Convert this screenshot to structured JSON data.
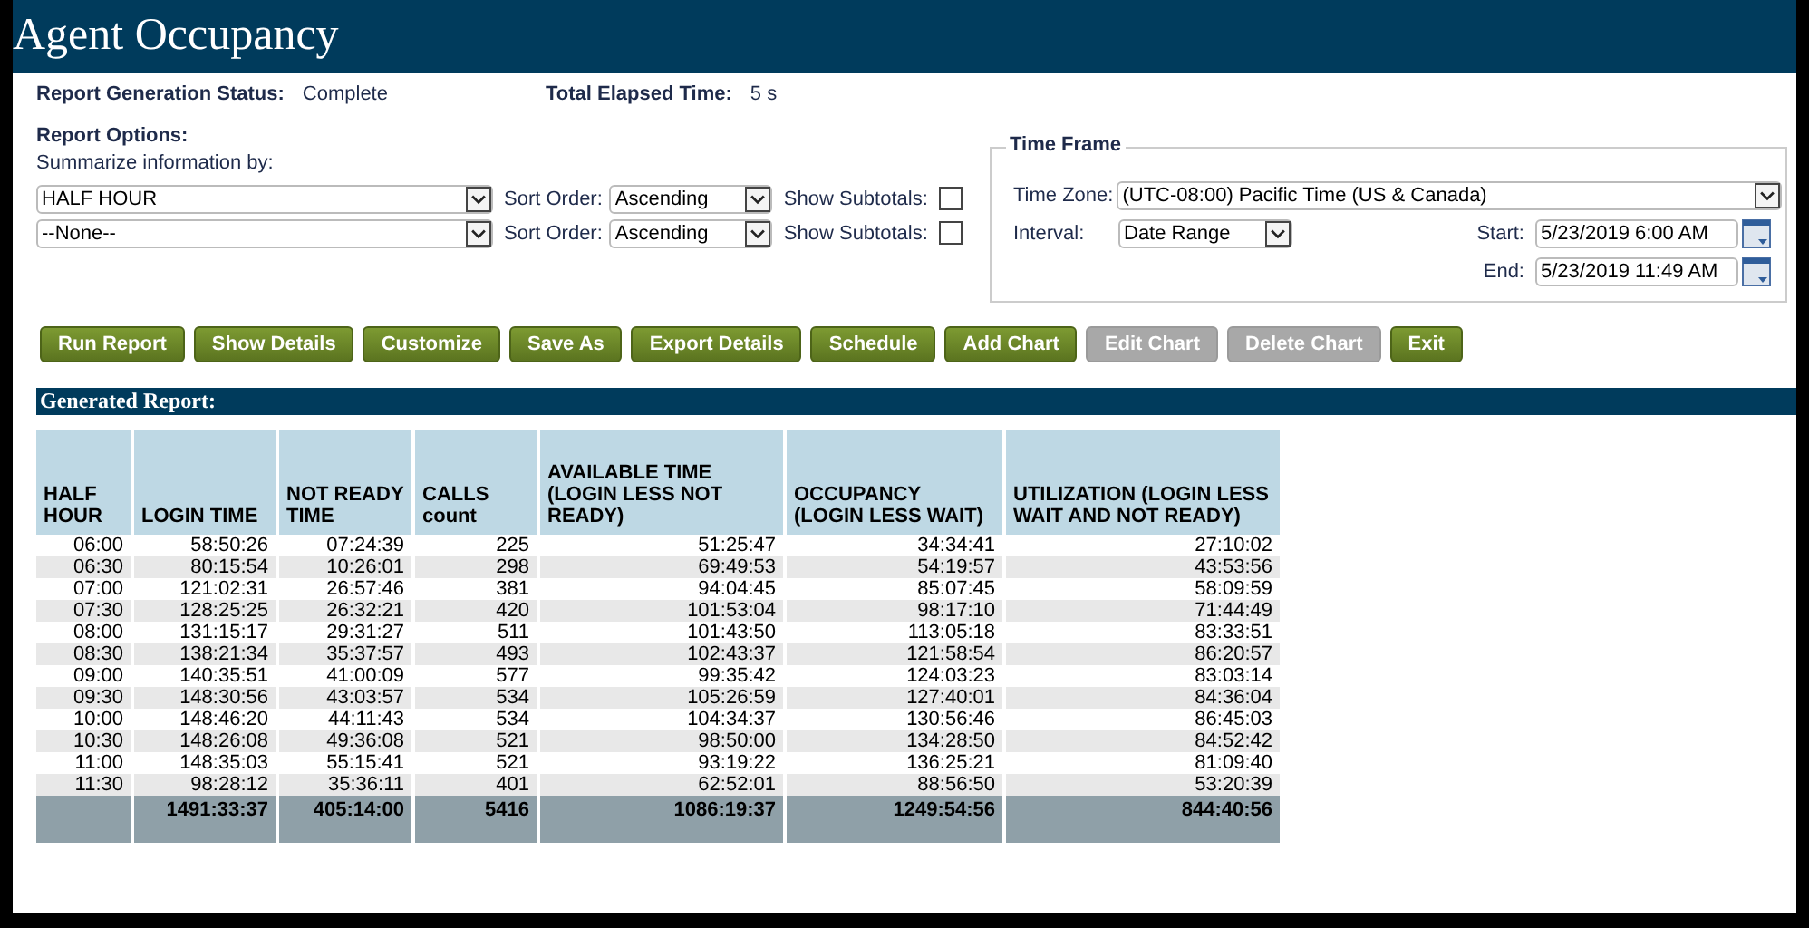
{
  "window": {
    "title": "Agent Occupancy"
  },
  "status": {
    "label": "Report Generation Status:",
    "value": "Complete",
    "elapsed_label": "Total Elapsed Time:",
    "elapsed_value": "5 s"
  },
  "report_options": {
    "title": "Report Options:",
    "summarize_label": "Summarize information by:",
    "rows": [
      {
        "group_by": "HALF HOUR",
        "sort_label": "Sort Order:",
        "sort": "Ascending",
        "subtotals_label": "Show Subtotals:",
        "checked": false
      },
      {
        "group_by": "--None--",
        "sort_label": "Sort Order:",
        "sort": "Ascending",
        "subtotals_label": "Show Subtotals:",
        "checked": false
      }
    ]
  },
  "time_frame": {
    "title": "Time Frame",
    "timezone_label": "Time Zone:",
    "timezone": "(UTC-08:00) Pacific Time (US & Canada)",
    "interval_label": "Interval:",
    "interval": "Date Range",
    "start_label": "Start:",
    "start": "5/23/2019 6:00 AM",
    "end_label": "End:",
    "end": "5/23/2019 11:49 AM"
  },
  "buttons": [
    {
      "label": "Run Report",
      "disabled": false
    },
    {
      "label": "Show Details",
      "disabled": false
    },
    {
      "label": "Customize",
      "disabled": false
    },
    {
      "label": "Save As",
      "disabled": false
    },
    {
      "label": "Export Details",
      "disabled": false
    },
    {
      "label": "Schedule",
      "disabled": false
    },
    {
      "label": "Add Chart",
      "disabled": false
    },
    {
      "label": "Edit Chart",
      "disabled": true
    },
    {
      "label": "Delete Chart",
      "disabled": true
    },
    {
      "label": "Exit",
      "disabled": false
    }
  ],
  "report_header": "Generated Report:",
  "table": {
    "columns": [
      "HALF HOUR",
      "LOGIN TIME",
      "NOT READY TIME",
      "CALLS count",
      "AVAILABLE TIME (LOGIN LESS NOT READY)",
      "OCCUPANCY (LOGIN LESS WAIT)",
      "UTILIZATION (LOGIN LESS WAIT AND NOT READY)"
    ],
    "rows": [
      [
        "06:00",
        "58:50:26",
        "07:24:39",
        "225",
        "51:25:47",
        "34:34:41",
        "27:10:02"
      ],
      [
        "06:30",
        "80:15:54",
        "10:26:01",
        "298",
        "69:49:53",
        "54:19:57",
        "43:53:56"
      ],
      [
        "07:00",
        "121:02:31",
        "26:57:46",
        "381",
        "94:04:45",
        "85:07:45",
        "58:09:59"
      ],
      [
        "07:30",
        "128:25:25",
        "26:32:21",
        "420",
        "101:53:04",
        "98:17:10",
        "71:44:49"
      ],
      [
        "08:00",
        "131:15:17",
        "29:31:27",
        "511",
        "101:43:50",
        "113:05:18",
        "83:33:51"
      ],
      [
        "08:30",
        "138:21:34",
        "35:37:57",
        "493",
        "102:43:37",
        "121:58:54",
        "86:20:57"
      ],
      [
        "09:00",
        "140:35:51",
        "41:00:09",
        "577",
        "99:35:42",
        "124:03:23",
        "83:03:14"
      ],
      [
        "09:30",
        "148:30:56",
        "43:03:57",
        "534",
        "105:26:59",
        "127:40:01",
        "84:36:04"
      ],
      [
        "10:00",
        "148:46:20",
        "44:11:43",
        "534",
        "104:34:37",
        "130:56:46",
        "86:45:03"
      ],
      [
        "10:30",
        "148:26:08",
        "49:36:08",
        "521",
        "98:50:00",
        "134:28:50",
        "84:52:42"
      ],
      [
        "11:00",
        "148:35:03",
        "55:15:41",
        "521",
        "93:19:22",
        "136:25:21",
        "81:09:40"
      ],
      [
        "11:30",
        "98:28:12",
        "35:36:11",
        "401",
        "62:52:01",
        "88:56:50",
        "53:20:39"
      ]
    ],
    "totals": [
      "1491:33:37",
      "405:14:00",
      "5416",
      "1086:19:37",
      "1249:54:56",
      "844:40:56"
    ]
  }
}
